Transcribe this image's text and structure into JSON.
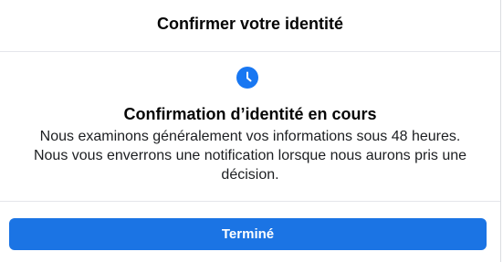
{
  "dialog": {
    "title": "Confirmer votre identité"
  },
  "status": {
    "icon": "clock-icon",
    "title": "Confirmation d’identité en cours",
    "lines": [
      "Nous examinons généralement vos informations sous 48 heures.",
      "Nous vous enverrons une notification lorsque nous aurons pris une",
      "décision."
    ]
  },
  "actions": {
    "done_label": "Terminé"
  },
  "colors": {
    "accent": "#1b74e4",
    "icon": "#1877f2",
    "divider": "#e4e6eb"
  }
}
